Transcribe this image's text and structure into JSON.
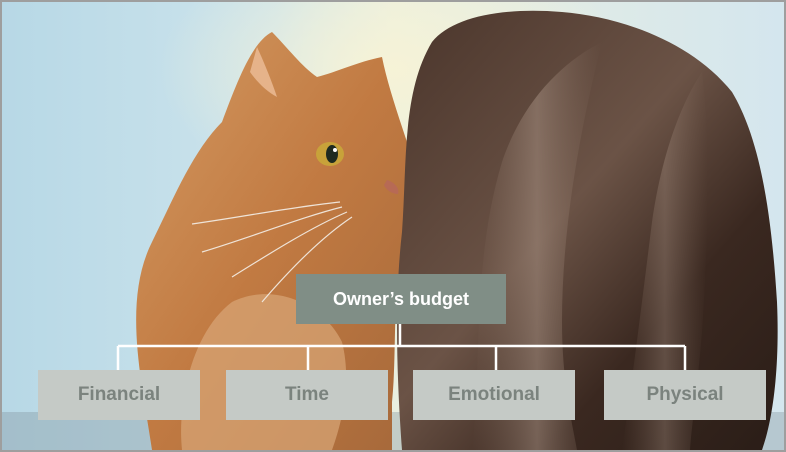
{
  "diagram": {
    "root": {
      "label": "Owner’s budget",
      "color": "#808e86",
      "text_color": "#ffffff"
    },
    "children": [
      {
        "label": "Financial"
      },
      {
        "label": "Time"
      },
      {
        "label": "Emotional"
      },
      {
        "label": "Physical"
      }
    ],
    "child_color": "#c5cac6",
    "child_text_color": "#7b837e",
    "connector_color": "#ffffff"
  },
  "background": {
    "subject": "cat-on-shoulder-photo",
    "colors": {
      "sky": "#bcd9e6",
      "cat_fur": "#c7804a",
      "hair": "#3b2a22"
    }
  }
}
